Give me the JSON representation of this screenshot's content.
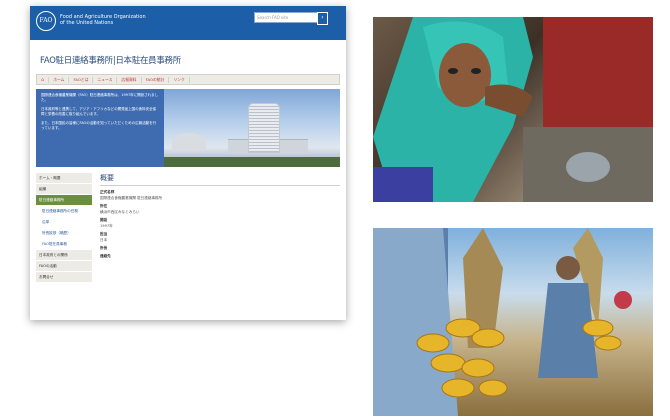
{
  "site": {
    "org_name_line1": "Food and Agriculture Organization",
    "org_name_line2": "of the United Nations",
    "logo_text": "FAO",
    "search_placeholder": "Search FAO site",
    "page_title": "FAO駐日連絡事務所|日本駐在員事務所",
    "nav_items": [
      "ホーム",
      "FAOとは",
      "ニュース",
      "広報資料",
      "FAOの統計",
      "リンク"
    ],
    "hero_paragraphs": [
      "国際連合食糧農業機関（FAO）駐日連絡事務所は、1997年に開設されました。",
      "日本政府等と連携して、アジア・アフリカなどの開発途上国の食料安全保障と栄養の改善に取り組んでいます。",
      "また、日本国民の皆様にFAOの活動を知っていただくための広報活動を行っています。"
    ],
    "sidenav": [
      {
        "label": "ホーム・概要",
        "type": "normal"
      },
      {
        "label": "組織",
        "type": "normal"
      },
      {
        "label": "駐日連絡事務所",
        "type": "active"
      },
      {
        "label": "駐日連絡事務所の任務",
        "type": "sub"
      },
      {
        "label": "沿革",
        "type": "sub"
      },
      {
        "label": "所長挨拶（略歴）",
        "type": "sub"
      },
      {
        "label": "FAO駐在員事務",
        "type": "sub"
      },
      {
        "label": "日本政府との関係",
        "type": "normal"
      },
      {
        "label": "FAOの活動",
        "type": "normal"
      },
      {
        "label": "お問合せ",
        "type": "normal"
      }
    ],
    "main_heading": "概要",
    "fields": [
      {
        "label": "正式名称",
        "value": "国際連合食糧農業機関 駐日連絡事務所"
      },
      {
        "label": "所在",
        "value": "横浜市西区みなとみらい"
      },
      {
        "label": "開設",
        "value": "1997年"
      },
      {
        "label": "担当",
        "value": "日本"
      },
      {
        "label": "所長",
        "value": ""
      },
      {
        "label": "連絡先",
        "value": ""
      }
    ]
  },
  "photos": {
    "photo1_alt": "woman-in-headscarf-eating",
    "photo2_alt": "farmers-holding-corn"
  }
}
